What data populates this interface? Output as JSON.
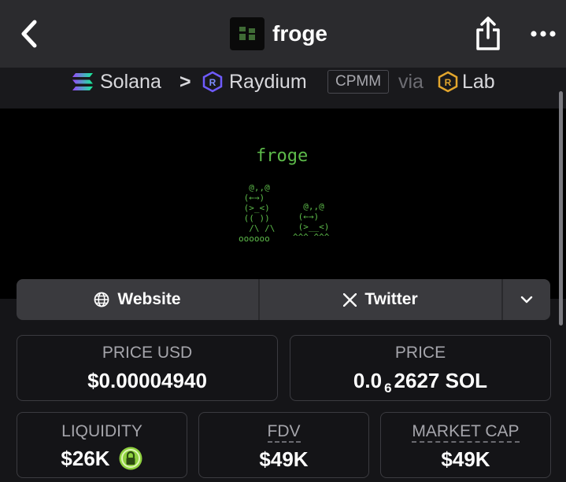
{
  "header": {
    "token_name": "froge",
    "back_icon": "chevron-left-icon",
    "share_icon": "share-icon",
    "more_icon": "ellipsis-icon"
  },
  "breadcrumb": {
    "chain": "Solana",
    "separator": ">",
    "dex": "Raydium",
    "pool_type": "CPMM",
    "via": "via",
    "launchpad": "Lab"
  },
  "banner": {
    "title": "froge"
  },
  "links": {
    "website_label": "Website",
    "twitter_label": "Twitter",
    "website_icon": "globe-icon",
    "twitter_icon": "x-icon",
    "expand_icon": "chevron-down-icon"
  },
  "stats": {
    "price_usd_label": "PRICE USD",
    "price_usd_value": "$0.00004940",
    "price_label": "PRICE",
    "price_prefix": "0.0",
    "price_zeros": "6",
    "price_rest": "2627 SOL",
    "liquidity_label": "LIQUIDITY",
    "liquidity_value": "$26K",
    "liquidity_icon": "lock-icon",
    "fdv_label": "FDV",
    "fdv_value": "$49K",
    "mcap_label": "MARKET CAP",
    "mcap_value": "$49K"
  },
  "colors": {
    "accent_green": "#5dbb4a",
    "lock_green": "#8fd13f",
    "background": "#151518",
    "header": "#2b2b2e"
  }
}
